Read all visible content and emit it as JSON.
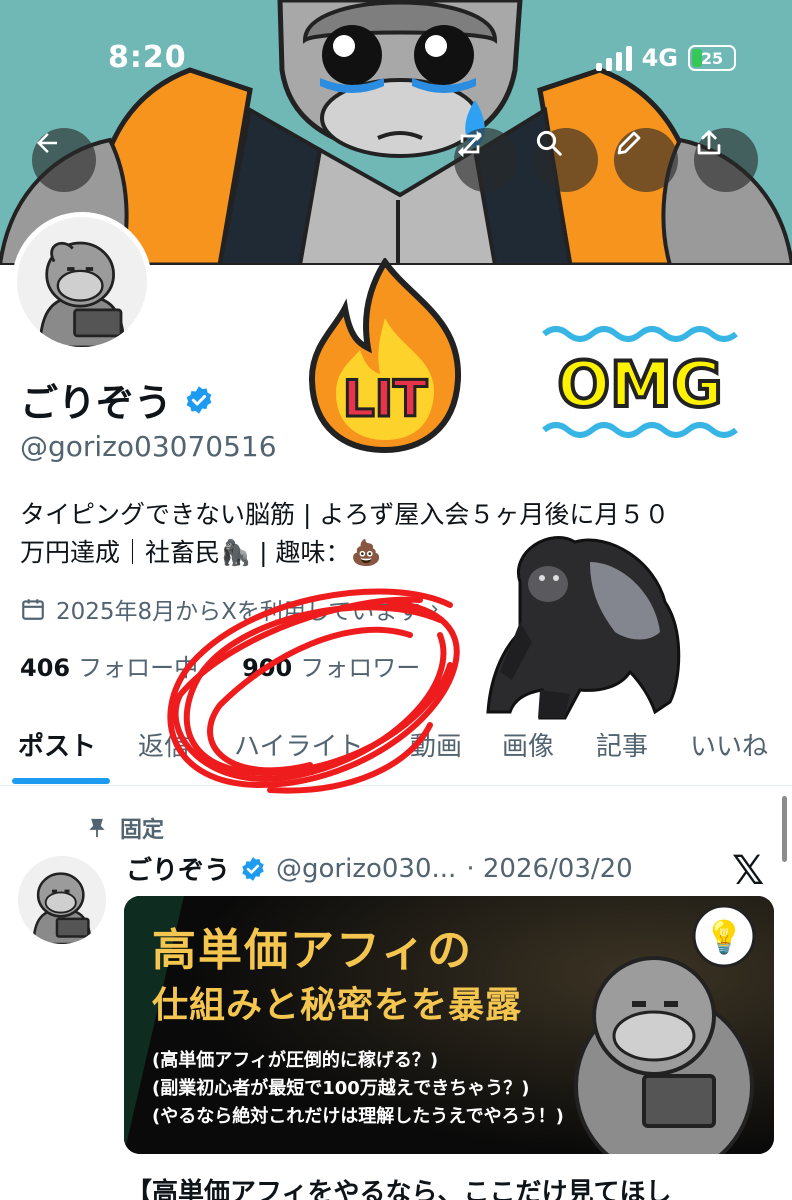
{
  "status_bar": {
    "time": "8:20",
    "network": "4G",
    "battery_level": "25"
  },
  "header": {
    "back_icon": "arrow-left-icon",
    "actions": [
      "retweet-icon",
      "search-icon",
      "edit-icon",
      "share-icon"
    ]
  },
  "profile": {
    "name": "ごりぞう",
    "handle": "@gorizo03070516",
    "bio_line1": "タイピングできない脳筋 | よろず屋入会５ヶ月後に月５０",
    "bio_line2": "万円達成｜社畜民🦍 | 趣味：💩",
    "joined": "2025年8月からXを利用しています",
    "following_count": "406",
    "following_label": "フォロー中",
    "followers_count": "900",
    "followers_label": "フォロワー"
  },
  "stickers": {
    "lit": "LIT",
    "omg": "OMG"
  },
  "tabs": [
    "ポスト",
    "返信",
    "ハイライト",
    "動画",
    "画像",
    "記事",
    "いいね"
  ],
  "active_tab": "ポスト",
  "pinned_post": {
    "pinned_label": "固定",
    "author_name": "ごりぞう",
    "author_handle": "@gorizo030...",
    "date": "· 2026/03/20",
    "media_title1": "高単価アフィの",
    "media_title2": "仕組みと秘密をを暴露",
    "media_lines": [
      "(高単価アフィが圧倒的に稼げる？)",
      "(副業初心者が最短で100万越えできちゃう？)",
      "(やるなら絶対これだけは理解したうえでやろう！)"
    ],
    "text": "【高単価アフィをやるなら、ここだけ見てほし"
  },
  "colors": {
    "accent": "#1d9bf0",
    "secondary_text": "#536471",
    "banner_bg": "#6fb8b6",
    "sticker_orange": "#f7941d",
    "omg_yellow": "#fff200"
  }
}
